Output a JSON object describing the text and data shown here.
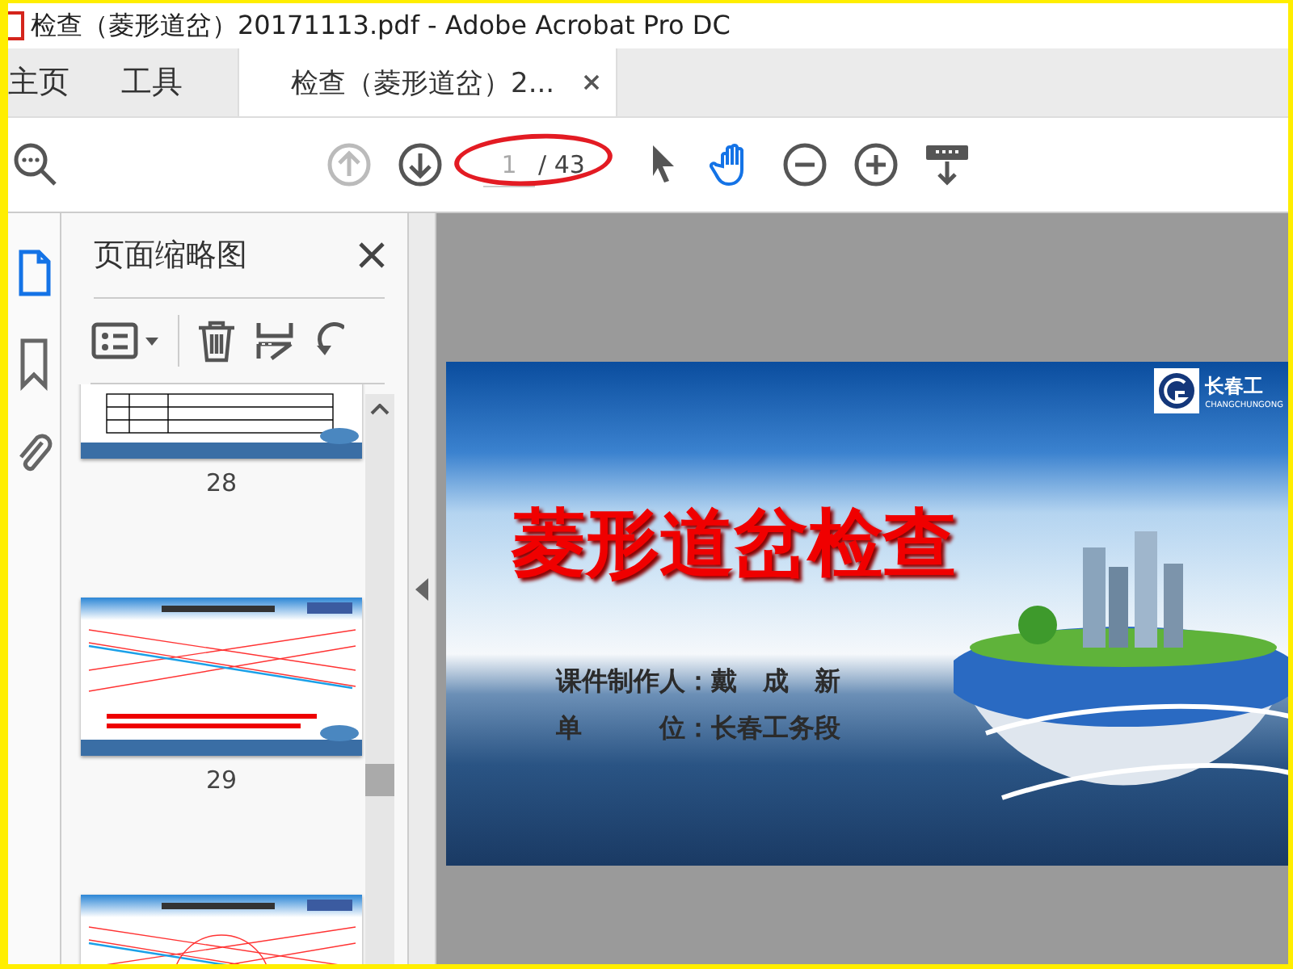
{
  "window": {
    "title": "检查（菱形道岔）20171113.pdf - Adobe Acrobat Pro DC"
  },
  "tabs": [
    {
      "label": "主页",
      "selected": false,
      "closable": false
    },
    {
      "label": "工具",
      "selected": false,
      "closable": false
    },
    {
      "label": "检查（菱形道岔）2...",
      "selected": true,
      "closable": true
    }
  ],
  "toolbar": {
    "tools_left": [
      {
        "kind": "search"
      }
    ],
    "nav": [
      {
        "kind": "prev-page",
        "disabled": true
      },
      {
        "kind": "next-page",
        "disabled": false
      }
    ],
    "page_input": {
      "value": "1"
    },
    "page_total": "/ 43",
    "tools": [
      {
        "kind": "select",
        "selected": false
      },
      {
        "kind": "hand",
        "selected": true
      },
      {
        "kind": "zoom-out",
        "selected": false
      },
      {
        "kind": "zoom-in",
        "selected": false
      },
      {
        "kind": "keyboard",
        "selected": false
      }
    ]
  },
  "left_rail": [
    {
      "kind": "pages",
      "selected": true
    },
    {
      "kind": "bookmark",
      "selected": false
    },
    {
      "kind": "attachment",
      "selected": false
    }
  ],
  "thumbnails_panel": {
    "title": "页面缩略图",
    "thumbnails": [
      {
        "kind": "table",
        "label": "28"
      },
      {
        "kind": "diagram",
        "label": "29"
      },
      {
        "kind": "diagram-circle"
      }
    ]
  },
  "slide": {
    "logo_text": "长春工",
    "logo_subtext": "CHANGCHUNGONG",
    "title": "菱形道岔检查",
    "lines": [
      "课件制作人：戴　成　新",
      "单　　　位：长春工务段"
    ]
  }
}
